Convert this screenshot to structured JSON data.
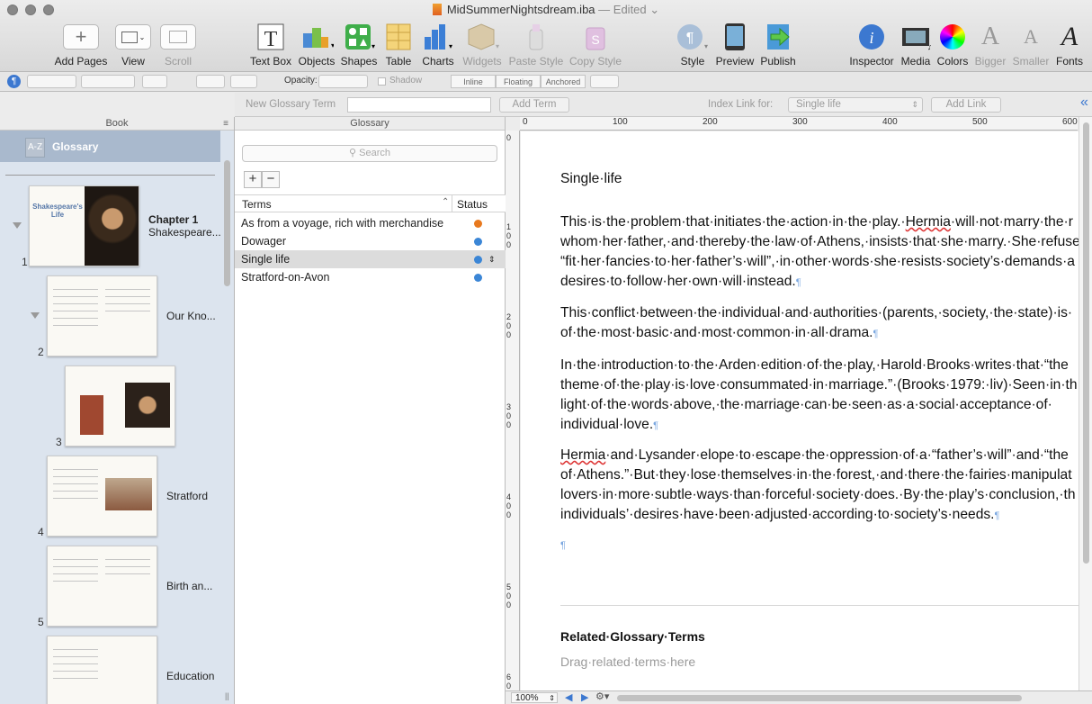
{
  "window": {
    "filename": "MidSummerNightsdream.iba",
    "status": "— Edited"
  },
  "toolbar": {
    "add_pages": "Add Pages",
    "view": "View",
    "scroll": "Scroll",
    "text_box": "Text Box",
    "objects": "Objects",
    "shapes": "Shapes",
    "table": "Table",
    "charts": "Charts",
    "widgets": "Widgets",
    "paste_style": "Paste Style",
    "copy_style": "Copy Style",
    "style": "Style",
    "preview": "Preview",
    "publish": "Publish",
    "inspector": "Inspector",
    "media": "Media",
    "colors": "Colors",
    "bigger": "Bigger",
    "smaller": "Smaller",
    "fonts": "Fonts"
  },
  "format_bar": {
    "opacity_label": "Opacity:",
    "shadow_label": "Shadow",
    "inline": "Inline",
    "floating": "Floating",
    "anchored": "Anchored"
  },
  "glossary_bar": {
    "new_term_label": "New Glossary Term",
    "add_term": "Add Term",
    "index_link_label": "Index Link for:",
    "index_link_value": "Single life",
    "add_link": "Add Link"
  },
  "sidebar": {
    "header": "Book",
    "glossary_label": "Glossary",
    "glossary_icon": "A-Z",
    "pages": [
      {
        "number": "1",
        "chapter": "Chapter 1",
        "title": "Shakespeare...",
        "thumb_title": "Shakespeare's Life"
      },
      {
        "number": "2",
        "title": "Our Kno..."
      },
      {
        "number": "3",
        "title": ""
      },
      {
        "number": "4",
        "title": "Stratford"
      },
      {
        "number": "5",
        "title": "Birth an..."
      },
      {
        "number": "",
        "title": "Education"
      }
    ]
  },
  "glossary": {
    "header": "Glossary",
    "search_placeholder": "Search",
    "add": "+",
    "remove": "−",
    "col_terms": "Terms",
    "col_status": "Status",
    "terms": [
      {
        "label": "As from a voyage, rich with merchandise",
        "status_color": "#e8791e"
      },
      {
        "label": "Dowager",
        "status_color": "#3b86d6"
      },
      {
        "label": "Single life",
        "status_color": "#3b86d6",
        "selected": true
      },
      {
        "label": "Stratford-on-Avon",
        "status_color": "#3b86d6"
      }
    ]
  },
  "ruler": {
    "top": [
      "0",
      "100",
      "200",
      "300",
      "400",
      "500",
      "600"
    ],
    "left": [
      "0",
      "100",
      "200",
      "300",
      "400",
      "500",
      "600"
    ]
  },
  "document": {
    "title": "Single·life",
    "p1": [
      "This·is·the·problem·that·initiates·the·action·in·the·play.·",
      "Hermia",
      "·will·not·marry·the·r",
      "whom·her·father,·and·thereby·the·law·of·Athens,·insists·that·she·marry.·She·refuse",
      "“fit·her·fancies·to·her·father’s·will”,·in·other·words·she·resists·society’s·demands·a",
      "desires·to·follow·her·own·will·instead."
    ],
    "p2": [
      "This·conflict·between·the·individual·and·authorities·(parents,·society,·the·state)·is·",
      "of·the·most·basic·and·most·common·in·all·drama."
    ],
    "p3": [
      "In·the·introduction·to·the·Arden·edition·of·the·play,·Harold·Brooks·writes·that·“the",
      "theme·of·the·play·is·love·consummated·in·marriage.”·(Brooks·1979:·liv)·Seen·in·th",
      "light·of·the·words·above,·the·marriage·can·be·seen·as·a·social·acceptance·of·",
      "individual·love."
    ],
    "p4": [
      "Hermia",
      "·and·Lysander·elope·to·escape·the·oppression·of·a·“father’s·will”·and·“the",
      "of·Athens.”·But·they·lose·themselves·in·the·forest,·and·there·the·fairies·manipulat",
      "lovers·in·more·subtle·ways·than·forceful·society·does.·By·the·play’s·conclusion,·th",
      "individuals’·desires·have·been·adjusted·according·to·society’s·needs."
    ],
    "pilcrow": "¶",
    "related_title": "Related·Glossary·Terms",
    "related_placeholder": "Drag·related·terms·here"
  },
  "bottom": {
    "zoom": "100%"
  }
}
